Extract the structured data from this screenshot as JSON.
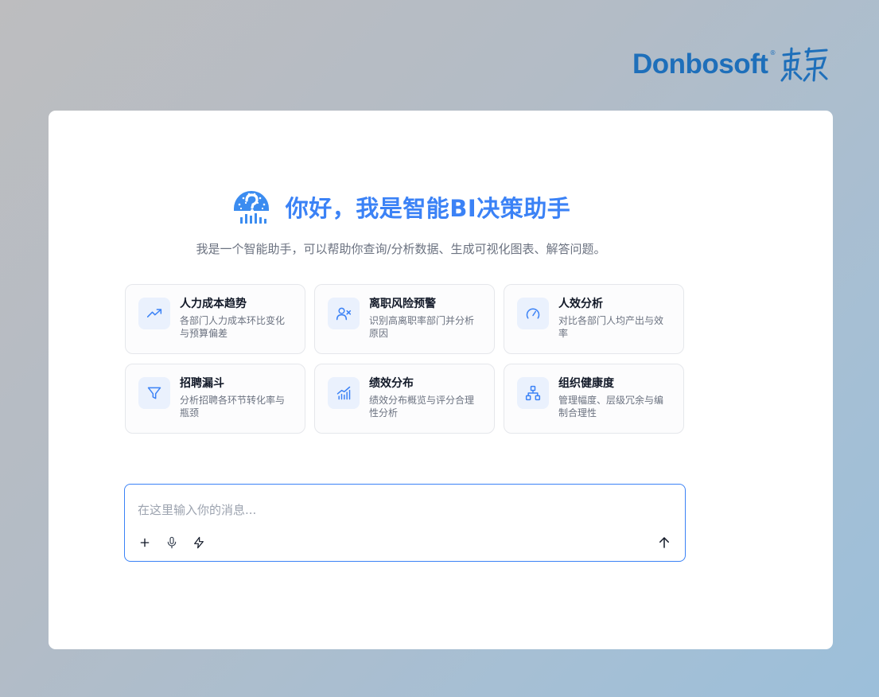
{
  "brand": {
    "name": "Donbosoft",
    "registered": "®"
  },
  "hero": {
    "title": "你好，我是智能BI决策助手",
    "subtitle": "我是一个智能助手，可以帮助你查询/分析数据、生成可视化图表、解答问题。"
  },
  "suggestions": [
    {
      "title": "人力成本趋势",
      "desc": "各部门人力成本环比变化与预算偏差",
      "icon": "trending-up-icon"
    },
    {
      "title": "离职风险预警",
      "desc": "识别高离职率部门并分析原因",
      "icon": "user-x-icon"
    },
    {
      "title": "人效分析",
      "desc": "对比各部门人均产出与效率",
      "icon": "gauge-icon"
    },
    {
      "title": "招聘漏斗",
      "desc": "分析招聘各环节转化率与瓶颈",
      "icon": "funnel-icon"
    },
    {
      "title": "绩效分布",
      "desc": "绩效分布概览与评分合理性分析",
      "icon": "chart-up-icon"
    },
    {
      "title": "组织健康度",
      "desc": "管理幅度、层级冗余与编制合理性",
      "icon": "org-chart-icon"
    }
  ],
  "composer": {
    "placeholder": "在这里输入你的消息...",
    "value": ""
  },
  "colors": {
    "accent": "#3b82f6",
    "brand": "#1e6fba",
    "tile_icon_bg": "#eaf1fd"
  }
}
